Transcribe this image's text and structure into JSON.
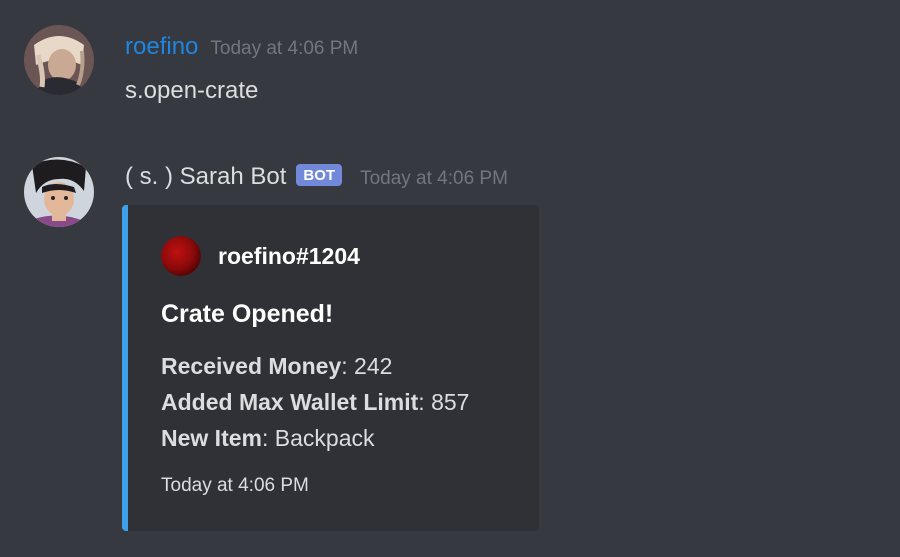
{
  "messages": [
    {
      "author": "roefino",
      "timestamp": "Today at 4:06 PM",
      "content": "s.open-crate",
      "avatar_icon": "user-avatar"
    },
    {
      "author": "( s. ) Sarah Bot",
      "bot_tag": "BOT",
      "timestamp": "Today at 4:06 PM",
      "avatar_icon": "bot-avatar",
      "embed": {
        "accent_color": "#3fa0ea",
        "author_icon": "red-circle-avatar",
        "author_name": "roefino#1204",
        "title": "Crate Opened!",
        "fields": [
          {
            "label": "Received Money",
            "separator": ": ",
            "value": "242"
          },
          {
            "label": "Added Max Wallet Limit",
            "separator": ": ",
            "value": "857"
          },
          {
            "label": "New Item",
            "separator": ": ",
            "value": "Backpack"
          }
        ],
        "footer": "Today at 4:06 PM"
      }
    }
  ],
  "colors": {
    "background": "#36393f",
    "embed_background": "#2f3136",
    "user_name": "#1e85e0",
    "bot_tag": "#7289da",
    "timestamp": "#72767d"
  }
}
